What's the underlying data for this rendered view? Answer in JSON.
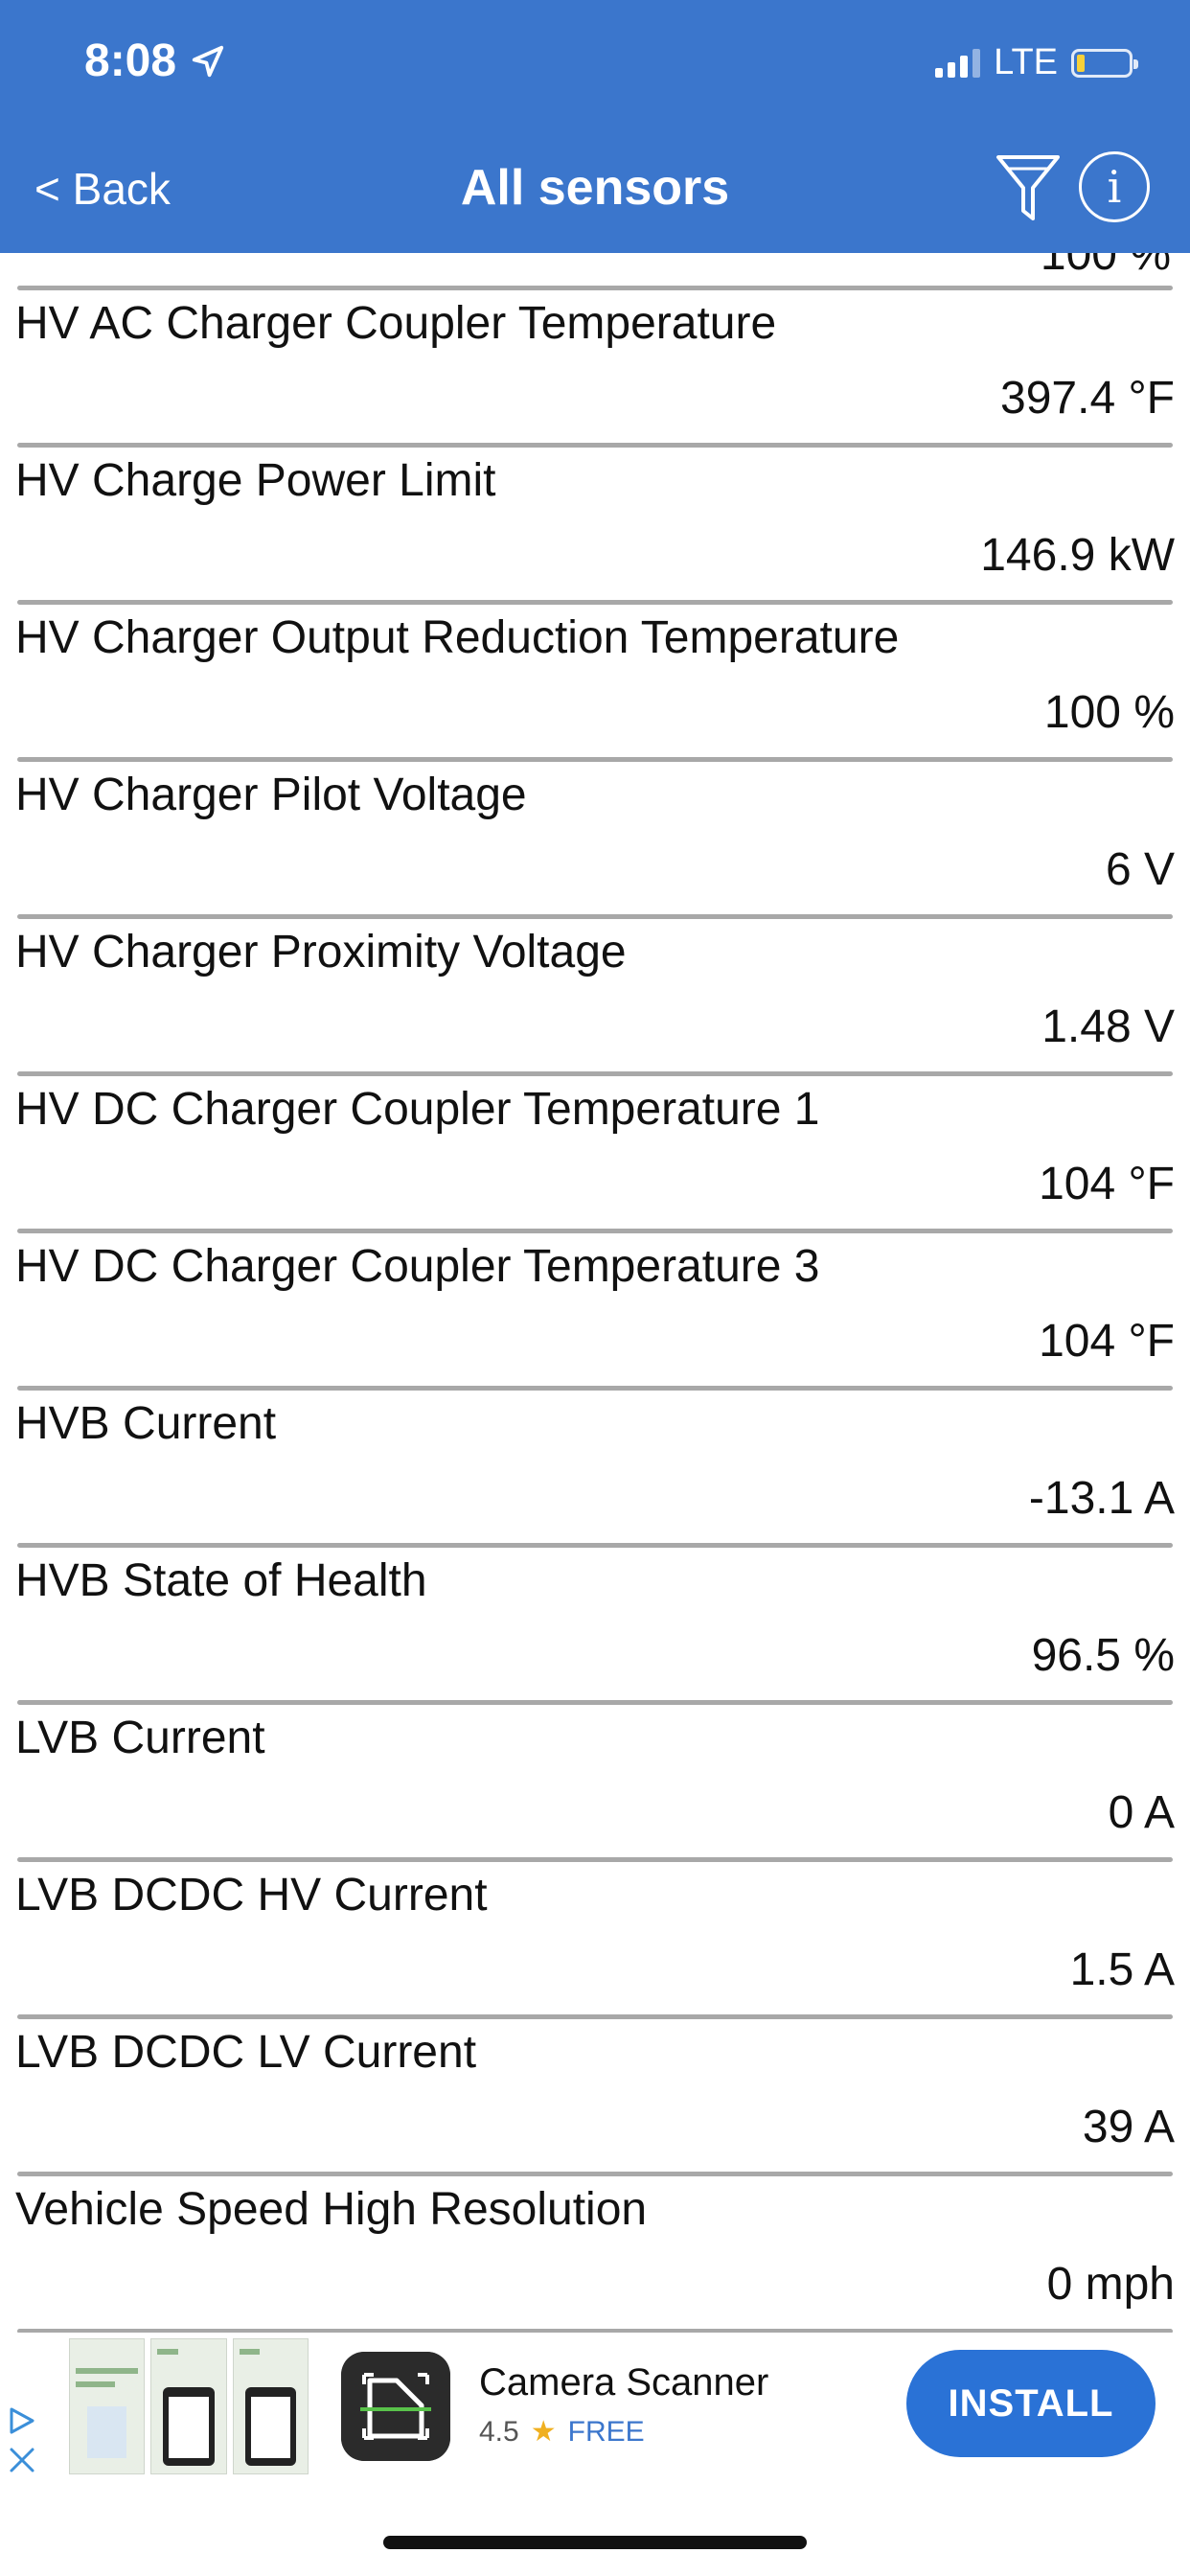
{
  "status_bar": {
    "time": "8:08",
    "network": "LTE"
  },
  "nav": {
    "back_label": "< Back",
    "title": "All sensors",
    "info_label": "i"
  },
  "list": {
    "partial_value": "100 %",
    "items": [
      {
        "label": "HV AC Charger Coupler Temperature",
        "value": "397.4 °F"
      },
      {
        "label": "HV Charge Power Limit",
        "value": "146.9 kW"
      },
      {
        "label": "HV Charger Output Reduction Temperature",
        "value": "100 %"
      },
      {
        "label": "HV Charger Pilot Voltage",
        "value": "6 V"
      },
      {
        "label": "HV Charger Proximity Voltage",
        "value": "1.48 V"
      },
      {
        "label": "HV DC Charger Coupler Temperature 1",
        "value": "104 °F"
      },
      {
        "label": "HV DC Charger Coupler Temperature 3",
        "value": "104 °F"
      },
      {
        "label": "HVB Current",
        "value": "-13.1 A"
      },
      {
        "label": "HVB State of Health",
        "value": "96.5 %"
      },
      {
        "label": "LVB Current",
        "value": "0 A"
      },
      {
        "label": "LVB DCDC HV Current",
        "value": "1.5 A"
      },
      {
        "label": "LVB DCDC LV Current",
        "value": "39 A"
      },
      {
        "label": "Vehicle Speed High Resolution",
        "value": "0 mph"
      }
    ]
  },
  "ad": {
    "app_name": "Camera Scanner",
    "rating": "4.5",
    "price": "FREE",
    "install_label": "INSTALL"
  },
  "colors": {
    "header_bg": "#3b76cc",
    "install_bg": "#2a72d6",
    "divider": "#a8a8a8"
  }
}
